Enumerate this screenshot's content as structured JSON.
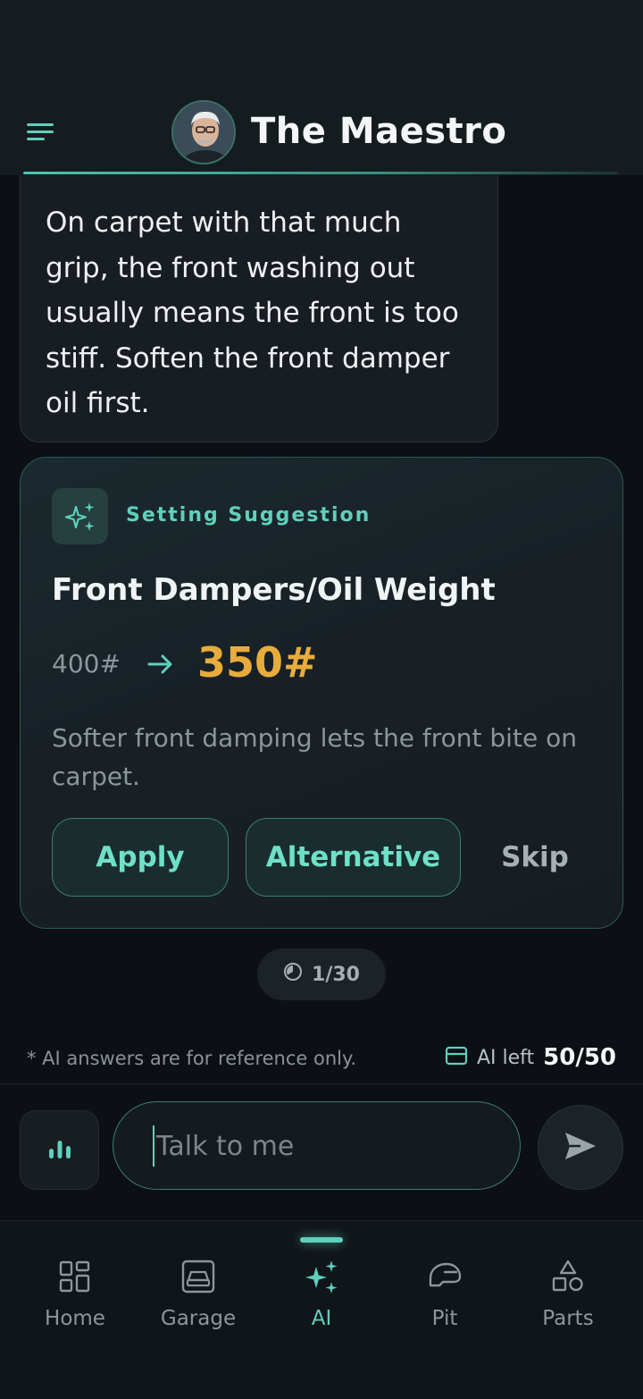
{
  "header": {
    "title": "The Maestro",
    "menu_icon": "hamburger-menu-icon",
    "avatar": "assistant-avatar"
  },
  "message": {
    "text": "On carpet with that much grip, the front washing out usually means the front is too stiff. Soften the front damper oil first."
  },
  "suggestion": {
    "kicker": "Setting Suggestion",
    "icon": "sparkles-icon",
    "title": "Front Dampers/Oil Weight",
    "old_value": "400#",
    "new_value": "350#",
    "description": "Softer front damping lets the front bite on carpet.",
    "apply_label": "Apply",
    "alternative_label": "Alternative",
    "skip_label": "Skip"
  },
  "counter": {
    "text": "1/30",
    "icon": "timer-icon"
  },
  "footer": {
    "disclaimer": "* AI answers are for reference only.",
    "quota_label": "AI left",
    "quota_value": "50/50",
    "quota_icon": "credit-card-icon"
  },
  "composer": {
    "placeholder": "Talk to me",
    "voice_icon": "audio-bars-icon",
    "send_icon": "send-icon"
  },
  "nav": {
    "items": [
      {
        "label": "Home",
        "icon": "grid-icon"
      },
      {
        "label": "Garage",
        "icon": "car-icon"
      },
      {
        "label": "AI",
        "icon": "sparkles-icon",
        "active": true
      },
      {
        "label": "Pit",
        "icon": "helmet-icon"
      },
      {
        "label": "Parts",
        "icon": "shapes-icon"
      }
    ]
  },
  "colors": {
    "accent": "#5fd0bc",
    "highlight": "#e8ac3c",
    "background": "#0c1014"
  }
}
